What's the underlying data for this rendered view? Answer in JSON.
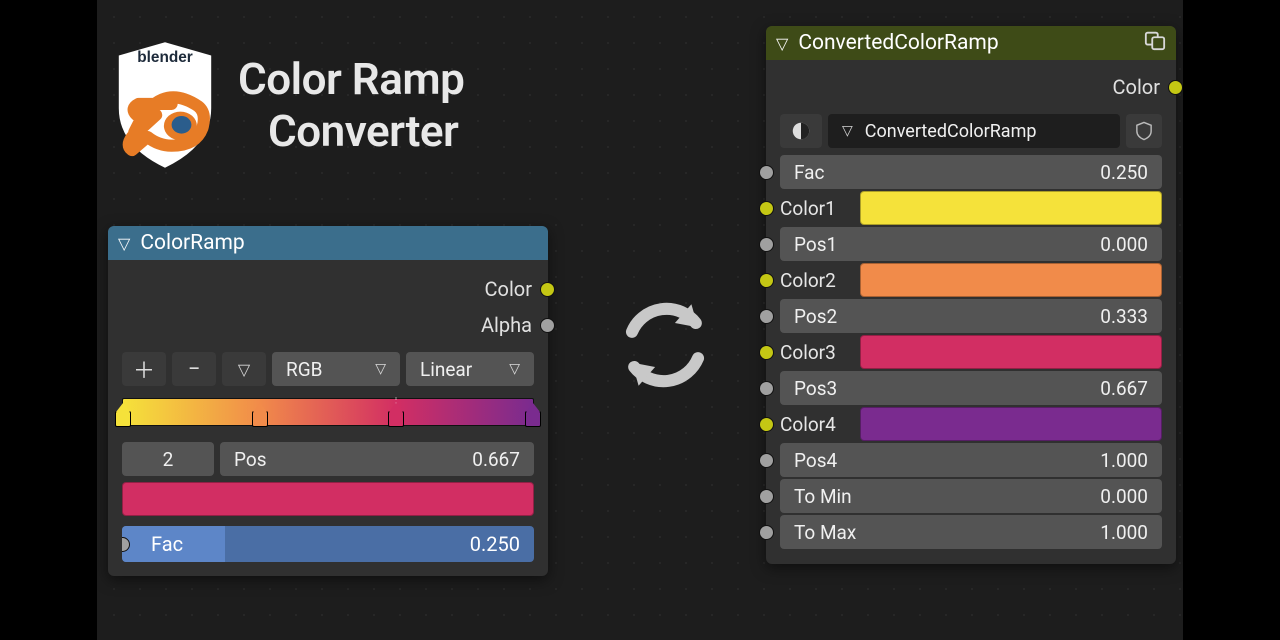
{
  "title_line1": "Color Ramp",
  "title_line2": "Converter",
  "logo_text": "blender",
  "left_node": {
    "title": "ColorRamp",
    "out_color": "Color",
    "out_alpha": "Alpha",
    "mode": "RGB",
    "interp": "Linear",
    "stops": [
      {
        "pos": 0.0,
        "color": "#f5e23a"
      },
      {
        "pos": 0.333,
        "color": "#f18b4a"
      },
      {
        "pos": 0.667,
        "color": "#d22e63"
      },
      {
        "pos": 1.0,
        "color": "#7a2b8f"
      }
    ],
    "selected_index": "2",
    "pos_label": "Pos",
    "pos_value": "0.667",
    "selected_color": "#d22e63",
    "fac_label": "Fac",
    "fac_value": "0.250",
    "fac_fill_pct": 25
  },
  "right_node": {
    "title": "ConvertedColorRamp",
    "out_color": "Color",
    "group_name": "ConvertedColorRamp",
    "rows": [
      {
        "kind": "num",
        "dot": "grey",
        "label": "Fac",
        "value": "0.250"
      },
      {
        "kind": "color",
        "dot": "yellow",
        "label": "Color1",
        "color": "#f5e23a"
      },
      {
        "kind": "num",
        "dot": "grey",
        "label": "Pos1",
        "value": "0.000"
      },
      {
        "kind": "color",
        "dot": "yellow",
        "label": "Color2",
        "color": "#f18b4a"
      },
      {
        "kind": "num",
        "dot": "grey",
        "label": "Pos2",
        "value": "0.333"
      },
      {
        "kind": "color",
        "dot": "yellow",
        "label": "Color3",
        "color": "#d22e63"
      },
      {
        "kind": "num",
        "dot": "grey",
        "label": "Pos3",
        "value": "0.667"
      },
      {
        "kind": "color",
        "dot": "yellow",
        "label": "Color4",
        "color": "#7a2b8f"
      },
      {
        "kind": "num",
        "dot": "grey",
        "label": "Pos4",
        "value": "1.000"
      },
      {
        "kind": "num",
        "dot": "grey",
        "label": "To Min",
        "value": "0.000"
      },
      {
        "kind": "num",
        "dot": "grey",
        "label": "To Max",
        "value": "1.000"
      }
    ]
  }
}
